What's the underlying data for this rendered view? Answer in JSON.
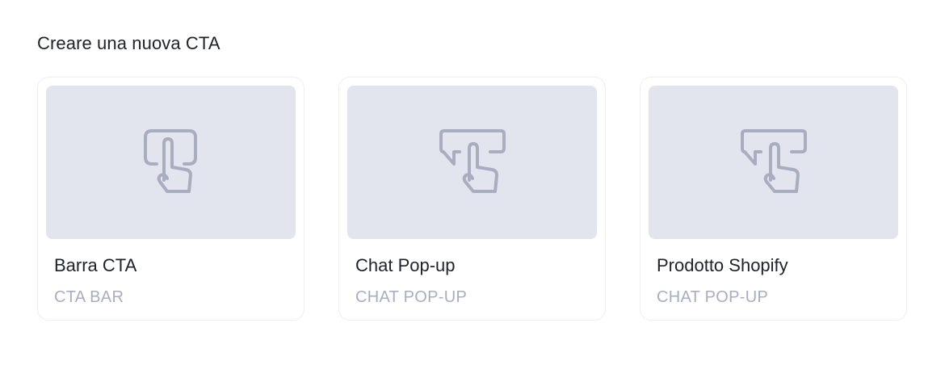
{
  "section": {
    "title": "Creare una nuova CTA"
  },
  "cards": [
    {
      "name": "Barra CTA",
      "type": "CTA BAR",
      "icon": "tap-button-icon"
    },
    {
      "name": "Chat Pop-up",
      "type": "CHAT POP-UP",
      "icon": "tap-chat-bubble-icon"
    },
    {
      "name": "Prodotto Shopify",
      "type": "CHAT POP-UP",
      "icon": "tap-chat-bubble-icon"
    }
  ],
  "colors": {
    "preview_bg": "#e2e4ee",
    "icon_stroke": "#a9adc0",
    "subtitle": "#a8aec2",
    "text": "#1e2229"
  }
}
